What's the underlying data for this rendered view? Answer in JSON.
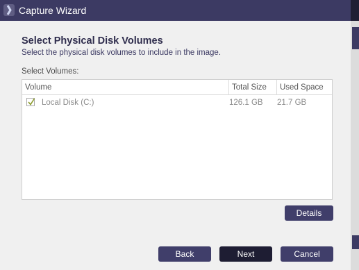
{
  "window": {
    "title": "Capture Wizard"
  },
  "page": {
    "heading": "Select Physical Disk Volumes",
    "subheading": "Select the physical disk volumes to include in the image.",
    "select_label": "Select Volumes:"
  },
  "table": {
    "columns": [
      "Volume",
      "Total Size",
      "Used Space"
    ],
    "rows": [
      {
        "checked": true,
        "volume": "Local Disk (C:)",
        "total_size": "126.1 GB",
        "used_space": "21.7 GB"
      }
    ]
  },
  "buttons": {
    "details": "Details",
    "back": "Back",
    "next": "Next",
    "cancel": "Cancel"
  },
  "colors": {
    "titlebar": "#3c3a63",
    "accent": "#403e6a",
    "primary_button": "#1e1d33",
    "checkmark": "#8a9a2a"
  }
}
